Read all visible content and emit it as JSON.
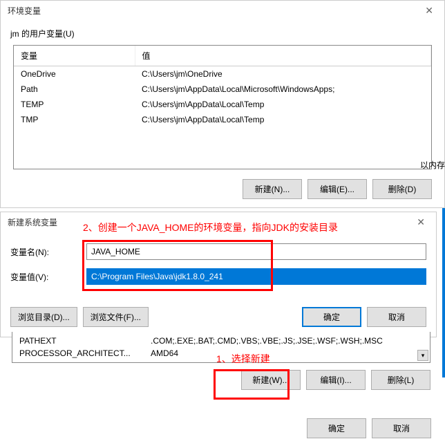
{
  "dialog1": {
    "title": "环境变量",
    "user_vars_label": "jm 的用户变量(U)",
    "headers": {
      "var": "变量",
      "val": "值"
    },
    "rows": [
      {
        "var": "OneDrive",
        "val": "C:\\Users\\jm\\OneDrive"
      },
      {
        "var": "Path",
        "val": "C:\\Users\\jm\\AppData\\Local\\Microsoft\\WindowsApps;"
      },
      {
        "var": "TEMP",
        "val": "C:\\Users\\jm\\AppData\\Local\\Temp"
      },
      {
        "var": "TMP",
        "val": "C:\\Users\\jm\\AppData\\Local\\Temp"
      }
    ],
    "buttons": {
      "new": "新建(N)...",
      "edit": "编辑(E)...",
      "delete": "删除(D)"
    }
  },
  "side_text": "以内存",
  "dialog2": {
    "title": "新建系统变量",
    "name_label": "变量名(N):",
    "name_value": "JAVA_HOME",
    "value_label": "变量值(V):",
    "value_value": "C:\\Program Files\\Java\\jdk1.8.0_241",
    "browse_dir": "浏览目录(D)...",
    "browse_file": "浏览文件(F)...",
    "ok": "确定",
    "cancel": "取消"
  },
  "annotations": {
    "a1": "1、选择新建",
    "a2": "2、创建一个JAVA_HOME的环境变量，指向JDK的安装目录"
  },
  "system_table": {
    "rows": [
      {
        "var": "PATHEXT",
        "val": ".COM;.EXE;.BAT;.CMD;.VBS;.VBE;.JS;.JSE;.WSF;.WSH;.MSC"
      },
      {
        "var": "PROCESSOR_ARCHITECT...",
        "val": "AMD64"
      }
    ],
    "buttons": {
      "new": "新建(W)...",
      "edit": "编辑(I)...",
      "delete": "删除(L)"
    }
  },
  "bottom": {
    "ok": "确定",
    "cancel": "取消"
  }
}
